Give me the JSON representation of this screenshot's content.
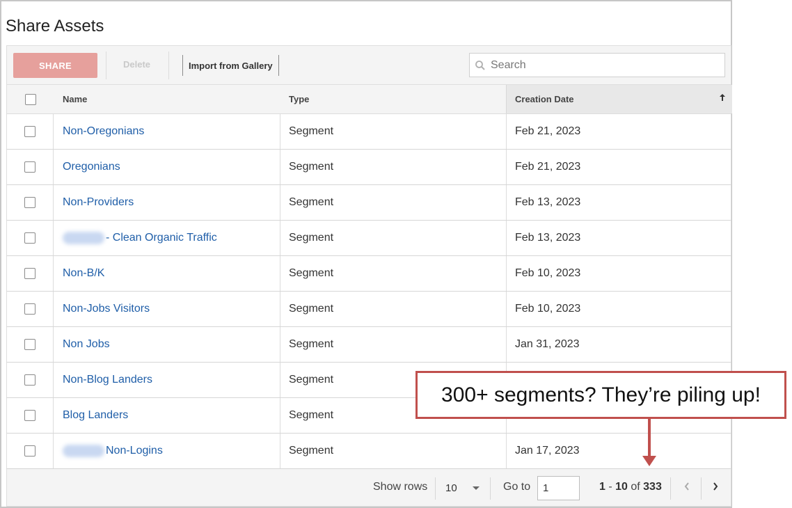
{
  "page": {
    "title": "Share Assets"
  },
  "toolbar": {
    "share_label": "SHARE",
    "delete_label": "Delete",
    "import_label": "Import from Gallery",
    "search_placeholder": "Search"
  },
  "colors": {
    "accent": "#e6a09c",
    "link": "#1f5ea8",
    "callout_border": "#c0504d"
  },
  "table": {
    "columns": {
      "name": "Name",
      "type": "Type",
      "date": "Creation Date"
    },
    "sort": "ascending",
    "rows": [
      {
        "name_prefix": "",
        "name": "Non-Oregonians",
        "redacted": false,
        "type": "Segment",
        "date": "Feb 21, 2023"
      },
      {
        "name_prefix": "",
        "name": "Oregonians",
        "redacted": false,
        "type": "Segment",
        "date": "Feb 21, 2023"
      },
      {
        "name_prefix": "",
        "name": "Non-Providers",
        "redacted": false,
        "type": "Segment",
        "date": "Feb 13, 2023"
      },
      {
        "name_prefix": "",
        "name": "- Clean Organic Traffic",
        "redacted": true,
        "type": "Segment",
        "date": "Feb 13, 2023"
      },
      {
        "name_prefix": "",
        "name": "Non-B/K",
        "redacted": false,
        "type": "Segment",
        "date": "Feb 10, 2023"
      },
      {
        "name_prefix": "",
        "name": "Non-Jobs Visitors",
        "redacted": false,
        "type": "Segment",
        "date": "Feb 10, 2023"
      },
      {
        "name_prefix": "",
        "name": "Non Jobs",
        "redacted": false,
        "type": "Segment",
        "date": "Jan 31, 2023"
      },
      {
        "name_prefix": "",
        "name": "Non-Blog Landers",
        "redacted": false,
        "type": "Segment",
        "date": ""
      },
      {
        "name_prefix": "",
        "name": "Blog Landers",
        "redacted": false,
        "type": "Segment",
        "date": ""
      },
      {
        "name_prefix": "",
        "name": "Non-Logins",
        "redacted": true,
        "type": "Segment",
        "date": "Jan 17, 2023"
      }
    ]
  },
  "footer": {
    "show_rows_label": "Show rows",
    "rows_per_page": "10",
    "goto_label": "Go to",
    "goto_value": "1",
    "range_start": "1",
    "range_dash": " - ",
    "range_end": "10",
    "range_of": " of ",
    "total": "333"
  },
  "callout": {
    "text": "300+ segments? They’re piling up!"
  },
  "icons": {
    "search": "search-icon",
    "sort": "sort-up-arrow-icon",
    "prev": "chevron-left-icon",
    "next": "chevron-right-icon",
    "dropdown": "caret-down-icon"
  }
}
